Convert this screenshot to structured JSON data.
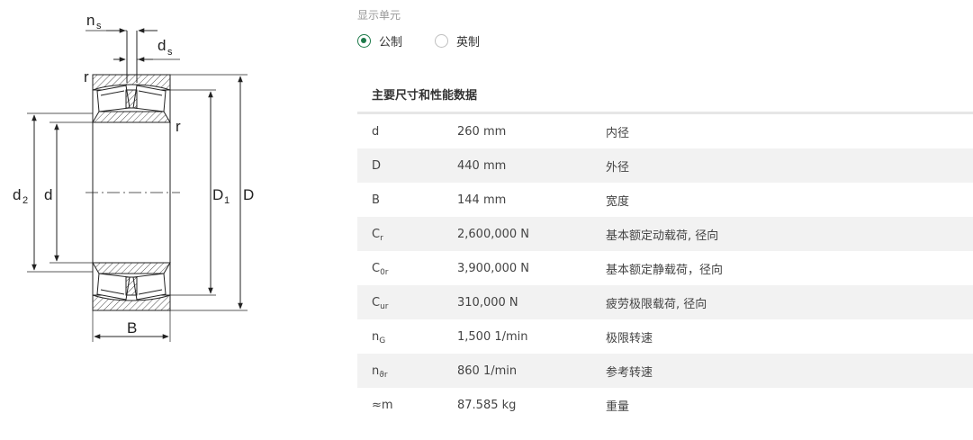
{
  "drawing": {
    "labels": {
      "ns": "n",
      "ns_sub": "s",
      "ds": "d",
      "ds_sub": "s",
      "r_top": "r",
      "r_mid": "r",
      "d2": "d",
      "d2_sub": "2",
      "d": "d",
      "D1": "D",
      "D1_sub": "1",
      "D": "D",
      "B": "B"
    }
  },
  "units": {
    "title": "显示单元",
    "options": [
      {
        "label": "公制",
        "checked": true
      },
      {
        "label": "英制",
        "checked": false
      }
    ]
  },
  "specs": {
    "title": "主要尺寸和性能数据",
    "rows": [
      {
        "sym": "d",
        "sub": "",
        "value": "260 mm",
        "desc": "内径"
      },
      {
        "sym": "D",
        "sub": "",
        "value": "440 mm",
        "desc": "外径"
      },
      {
        "sym": "B",
        "sub": "",
        "value": "144 mm",
        "desc": "宽度"
      },
      {
        "sym": "C",
        "sub": "r",
        "value": "2,600,000 N",
        "desc": "基本额定动载荷, 径向"
      },
      {
        "sym": "C",
        "sub": "0r",
        "value": "3,900,000 N",
        "desc": "基本额定静载荷，径向"
      },
      {
        "sym": "C",
        "sub": "ur",
        "value": "310,000 N",
        "desc": "疲劳极限载荷, 径向"
      },
      {
        "sym": "n",
        "sub": "G",
        "value": "1,500 1/min",
        "desc": "极限转速"
      },
      {
        "sym": "n",
        "sub": "ϑr",
        "value": "860 1/min",
        "desc": "参考转速"
      },
      {
        "sym": "≈m",
        "sub": "",
        "value": "87.585 kg",
        "desc": "重量"
      }
    ]
  }
}
